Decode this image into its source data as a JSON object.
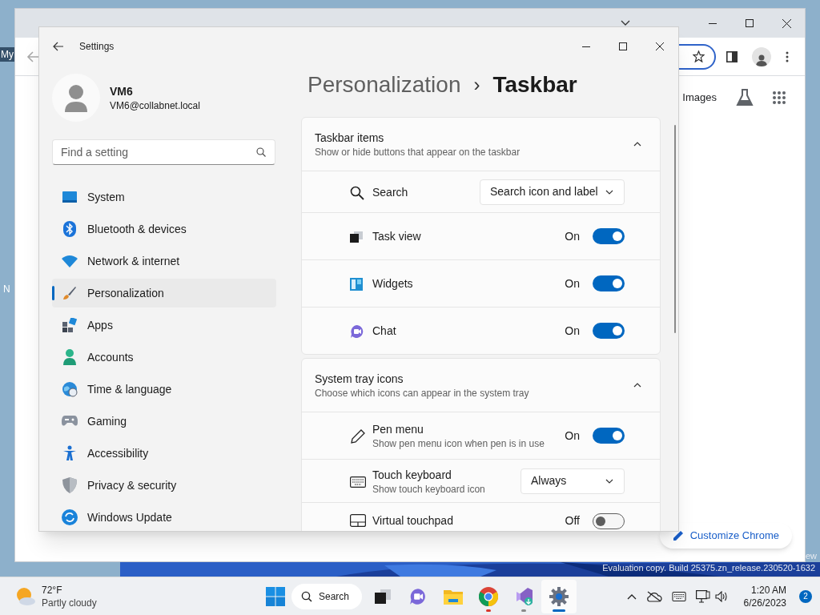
{
  "desktop": {
    "icon_labels": [
      "My",
      "N"
    ],
    "watermark": [
      "ew",
      "Evaluation copy. Build 25375.zn_release.230520-1632"
    ]
  },
  "browser": {
    "images_link": "Images",
    "customize_button": "Customize Chrome"
  },
  "settings": {
    "title": "Settings",
    "user": {
      "name": "VM6",
      "email": "VM6@collabnet.local"
    },
    "search": {
      "placeholder": "Find a setting"
    },
    "nav": [
      {
        "label": "System",
        "selected": false
      },
      {
        "label": "Bluetooth & devices",
        "selected": false
      },
      {
        "label": "Network & internet",
        "selected": false
      },
      {
        "label": "Personalization",
        "selected": true
      },
      {
        "label": "Apps",
        "selected": false
      },
      {
        "label": "Accounts",
        "selected": false
      },
      {
        "label": "Time & language",
        "selected": false
      },
      {
        "label": "Gaming",
        "selected": false
      },
      {
        "label": "Accessibility",
        "selected": false
      },
      {
        "label": "Privacy & security",
        "selected": false
      },
      {
        "label": "Windows Update",
        "selected": false
      }
    ],
    "breadcrumb": {
      "parent": "Personalization",
      "separator": "›",
      "current": "Taskbar"
    },
    "sections": [
      {
        "title": "Taskbar items",
        "subtitle": "Show or hide buttons that appear on the taskbar",
        "expanded": true,
        "rows": [
          {
            "kind": "dropdown",
            "label": "Search",
            "value": "Search icon and label"
          },
          {
            "kind": "toggle",
            "label": "Task view",
            "state": "On",
            "on": true
          },
          {
            "kind": "toggle",
            "label": "Widgets",
            "state": "On",
            "on": true
          },
          {
            "kind": "toggle",
            "label": "Chat",
            "state": "On",
            "on": true
          }
        ]
      },
      {
        "title": "System tray icons",
        "subtitle": "Choose which icons can appear in the system tray",
        "expanded": true,
        "rows": [
          {
            "kind": "toggle",
            "label": "Pen menu",
            "description": "Show pen menu icon when pen is in use",
            "state": "On",
            "on": true
          },
          {
            "kind": "dropdown",
            "label": "Touch keyboard",
            "description": "Show touch keyboard icon",
            "value": "Always"
          },
          {
            "kind": "toggle",
            "label": "Virtual touchpad",
            "state": "Off",
            "on": false
          }
        ]
      }
    ]
  },
  "taskbar": {
    "weather": {
      "temperature": "72°F",
      "condition": "Partly cloudy"
    },
    "search_label": "Search",
    "apps": [
      {
        "selected": false
      },
      {
        "selected": false
      },
      {
        "selected": false
      },
      {
        "selected": false,
        "color": "#d9342b"
      },
      {
        "selected": false,
        "color": "#8a8a8a"
      },
      {
        "selected": true,
        "color": "#0067c0"
      }
    ],
    "clock": {
      "time": "1:20 AM",
      "date": "6/26/2023"
    },
    "notification_count": "2"
  }
}
